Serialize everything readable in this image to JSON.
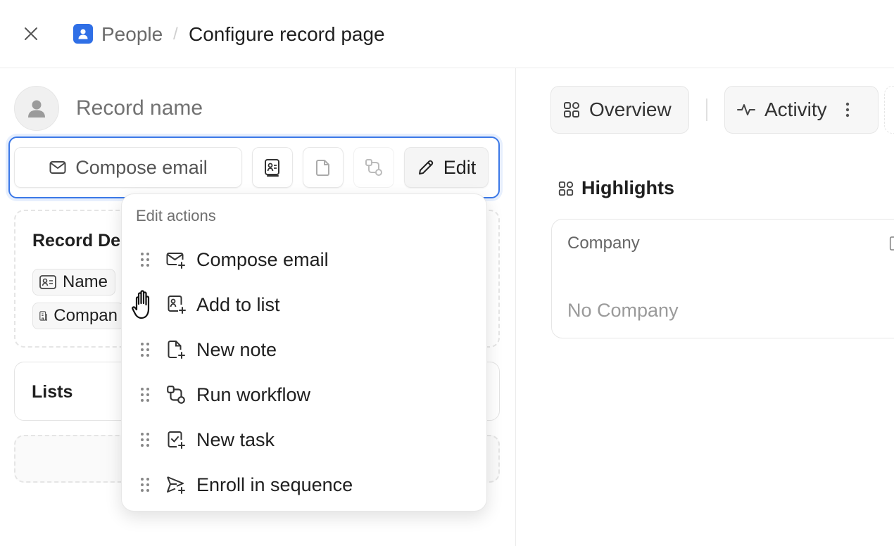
{
  "header": {
    "parent": "People",
    "separator": "/",
    "title": "Configure record page"
  },
  "record": {
    "name_placeholder": "Record name"
  },
  "actions": {
    "compose_label": "Compose email",
    "edit_label": "Edit"
  },
  "left_cards": {
    "details_title": "Record De",
    "fields": [
      "Name",
      "Compan"
    ],
    "lists_title": "Lists"
  },
  "tabs": [
    {
      "label": "Overview"
    },
    {
      "label": "Activity"
    }
  ],
  "highlights": {
    "title": "Highlights",
    "company_label": "Company",
    "company_value": "No Company"
  },
  "dropdown": {
    "title": "Edit actions",
    "items": [
      {
        "label": "Compose email",
        "icon": "mail-plus-icon"
      },
      {
        "label": "Add to list",
        "icon": "list-add-icon"
      },
      {
        "label": "New note",
        "icon": "note-plus-icon"
      },
      {
        "label": "Run workflow",
        "icon": "workflow-icon"
      },
      {
        "label": "New task",
        "icon": "task-plus-icon"
      },
      {
        "label": "Enroll in sequence",
        "icon": "send-plus-icon"
      }
    ]
  },
  "colors": {
    "accent": "#3b78e7",
    "app_icon": "#2f6fe6"
  }
}
